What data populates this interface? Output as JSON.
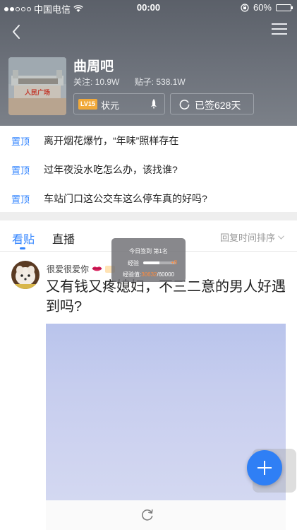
{
  "status_bar": {
    "carrier": "中国电信",
    "time": "00:00",
    "battery": "60%",
    "battery_level": 0.6
  },
  "header": {
    "forum_name": "曲周吧",
    "followers_label": "关注: 10.9W",
    "posts_label": "贴子: 538.1W",
    "level_badge": "LV15",
    "level_title": "状元",
    "sign_label": "已签628天",
    "image_sign_text": "人民广场"
  },
  "pinned": {
    "tag": "置顶",
    "items": [
      "离开烟花爆竹，“年味”照样存在",
      "过年夜没水吃怎么办，该找谁?",
      "车站门口这公交车这么停车真的好吗?"
    ]
  },
  "tabs": {
    "posts": "看贴",
    "live": "直播",
    "sort": "回复时间排序"
  },
  "post": {
    "author": "很爱很爱你",
    "title": "又有钱又疼媳妇，不三二意的男人好遇到吗?"
  },
  "sign_popup": {
    "line1": "今日签到 第1名",
    "exp_label": "经验",
    "exp_plus": "+8",
    "exp_prefix": "经验值:",
    "exp_current": "30632",
    "exp_total": "/60000",
    "exp_progress": 0.51
  },
  "icons": [
    "back-icon",
    "menu-icon",
    "rocket-icon",
    "sign-refresh-icon",
    "chevron-down-icon",
    "refresh-icon",
    "plus-icon"
  ],
  "colors": {
    "accent": "#3385ff",
    "level_badge": "#f0a93a",
    "fab": "#2f7ff5"
  }
}
